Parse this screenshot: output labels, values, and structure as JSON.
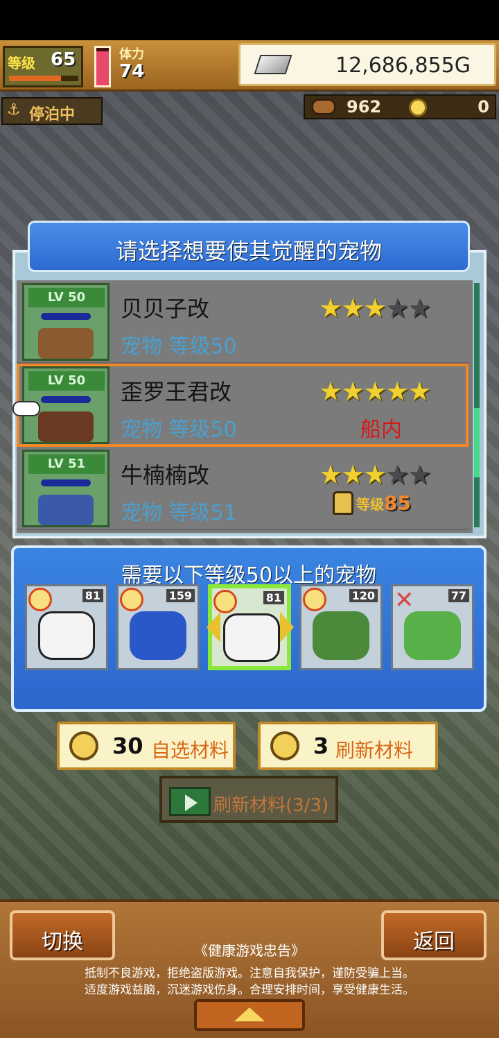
{
  "hud": {
    "level_label": "等级",
    "level_value": "65",
    "level_progress": 0.75,
    "stamina_label": "体力",
    "stamina_value": "74",
    "stamina_level": 0.9,
    "gold": "12,686,855G",
    "status": "停泊中",
    "resource_1": "962",
    "resource_2": "0"
  },
  "dialog": {
    "title": "请选择想要使其觉醒的宠物",
    "pets": [
      {
        "lv": "LV 50",
        "name": "贝贝子改",
        "sub": "宠物 等级50",
        "stars": 3,
        "tag": ""
      },
      {
        "lv": "LV 50",
        "name": "歪罗王君改",
        "sub": "宠物 等级50",
        "stars": 5,
        "tag": "船内"
      },
      {
        "lv": "LV 51",
        "name": "牛楠楠改",
        "sub": "宠物 等级51",
        "stars": 3,
        "lock_label": "等级",
        "lock_level": "85"
      }
    ]
  },
  "materials": {
    "title": "需要以下等级50以上的宠物",
    "cards": [
      {
        "num": "81"
      },
      {
        "num": "159"
      },
      {
        "num": "81"
      },
      {
        "num": "120"
      },
      {
        "num": "77"
      }
    ]
  },
  "buttons": {
    "choose_cost": "30",
    "choose_label": "自选材料",
    "refresh_cost": "3",
    "refresh_label": "刷新材料",
    "video_label": "刷新材料(3/3)"
  },
  "footer": {
    "switch_label": "切换",
    "back_label": "返回",
    "health_title": "《健康游戏忠告》",
    "health_line1": "抵制不良游戏，拒绝盗版游戏。注意自我保护，谨防受骗上当。",
    "health_line2": "适度游戏益脑，沉迷游戏伤身。合理安排时间，享受健康生活。"
  },
  "colors": {
    "accent": "#f08828",
    "panel_blue": "#2c66cc",
    "star": "#f2d030"
  }
}
